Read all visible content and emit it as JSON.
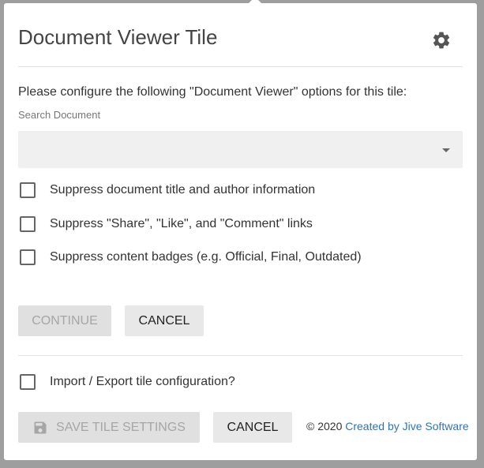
{
  "dialog": {
    "title": "Document Viewer Tile",
    "settings_icon": "gear-icon"
  },
  "form": {
    "intro": "Please configure the following \"Document Viewer\" options for this tile:",
    "search_label": "Search Document",
    "search_value": "",
    "options": [
      {
        "label": "Suppress document title and author information",
        "checked": false
      },
      {
        "label": "Suppress \"Share\", \"Like\", and \"Comment\" links",
        "checked": false
      },
      {
        "label": "Suppress content badges (e.g. Official, Final, Outdated)",
        "checked": false
      }
    ],
    "continue_label": "CONTINUE",
    "cancel_label": "CANCEL"
  },
  "footer": {
    "import_export_label": "Import / Export tile configuration?",
    "save_label": "SAVE TILE SETTINGS",
    "save_icon": "floppy-disk-icon",
    "cancel_label": "CANCEL",
    "copyright": "© 2020",
    "credit_link": "Created by Jive Software",
    "link_color": "#2f73b7"
  }
}
